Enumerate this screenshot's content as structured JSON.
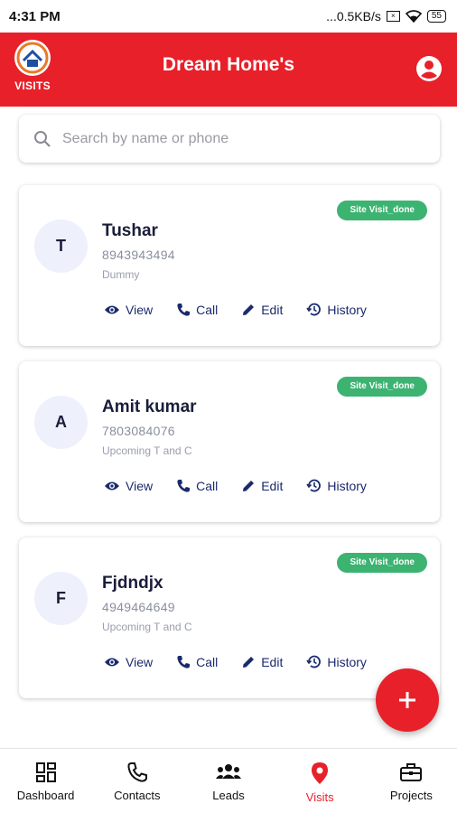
{
  "status_bar": {
    "time": "4:31 PM",
    "network": "...0.5KB/s",
    "battery": "55"
  },
  "header": {
    "title": "Dream Home's",
    "logo_caption": "VISITS"
  },
  "search": {
    "placeholder": "Search by name or phone"
  },
  "colors": {
    "brand": "#e8202a",
    "badge": "#3cb371",
    "action_text": "#1a2a6c",
    "avatar_bg": "#eef1fb"
  },
  "cards": [
    {
      "initial": "T",
      "name": "Tushar",
      "phone": "8943943494",
      "note": "Dummy",
      "badge": "Site Visit_done"
    },
    {
      "initial": "A",
      "name": "Amit kumar",
      "phone": "7803084076",
      "note": "Upcoming T and C",
      "badge": "Site Visit_done"
    },
    {
      "initial": "F",
      "name": "Fjdndjx",
      "phone": "4949464649",
      "note": "Upcoming T and C",
      "badge": "Site Visit_done"
    }
  ],
  "actions": {
    "view": "View",
    "call": "Call",
    "edit": "Edit",
    "history": "History"
  },
  "bottom_nav": [
    {
      "label": "Dashboard",
      "icon": "dashboard-icon"
    },
    {
      "label": "Contacts",
      "icon": "phone-icon"
    },
    {
      "label": "Leads",
      "icon": "group-icon"
    },
    {
      "label": "Visits",
      "icon": "location-pin-icon",
      "active": true
    },
    {
      "label": "Projects",
      "icon": "briefcase-icon"
    }
  ]
}
